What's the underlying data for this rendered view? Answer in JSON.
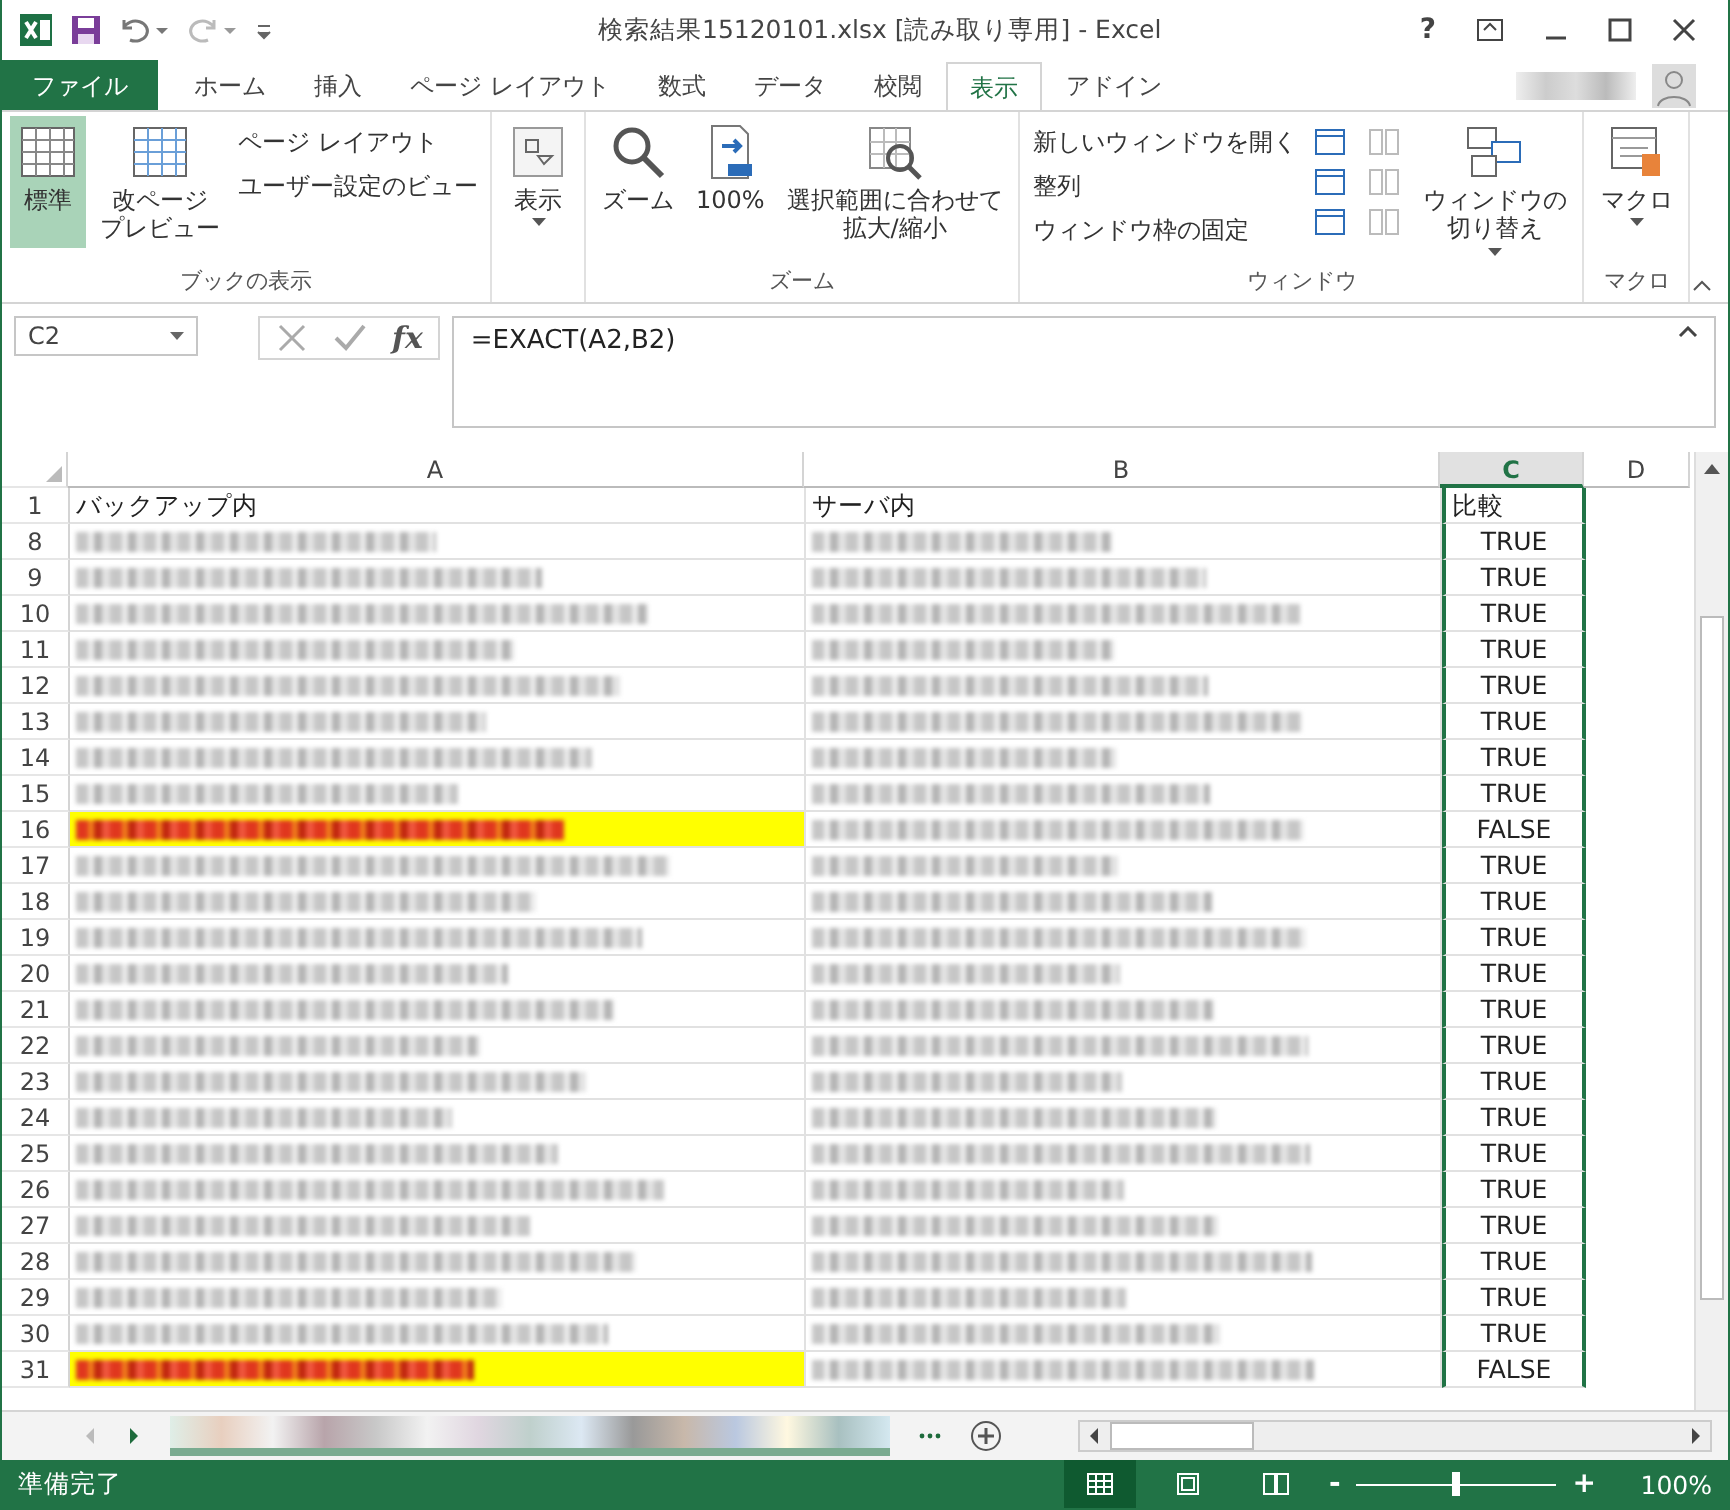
{
  "window": {
    "title": "検索結果15120101.xlsx  [読み取り専用] - Excel",
    "help": "?"
  },
  "tabs": [
    {
      "label": "ファイル",
      "kind": "file",
      "selected": false
    },
    {
      "label": "ホーム",
      "kind": "tab",
      "selected": false
    },
    {
      "label": "挿入",
      "kind": "tab",
      "selected": false
    },
    {
      "label": "ページ レイアウト",
      "kind": "tab",
      "selected": false
    },
    {
      "label": "数式",
      "kind": "tab",
      "selected": false
    },
    {
      "label": "データ",
      "kind": "tab",
      "selected": false
    },
    {
      "label": "校閲",
      "kind": "tab",
      "selected": false
    },
    {
      "label": "表示",
      "kind": "tab",
      "selected": true
    },
    {
      "label": "アドイン",
      "kind": "tab",
      "selected": false
    }
  ],
  "ribbon": {
    "groups": [
      {
        "label": "ブックの表示",
        "large": [
          {
            "lines": [
              "標準"
            ],
            "selected": true,
            "dropdown": false
          },
          {
            "lines": [
              "改ページ",
              "プレビュー"
            ],
            "selected": false,
            "dropdown": false
          }
        ],
        "small": [
          "ページ レイアウト",
          "ユーザー設定のビュー"
        ]
      },
      {
        "large": [
          {
            "lines": [
              "表示"
            ],
            "selected": false,
            "dropdown": true
          }
        ]
      },
      {
        "label": "ズーム",
        "large": [
          {
            "lines": [
              "ズーム"
            ],
            "selected": false,
            "dropdown": false
          },
          {
            "lines": [
              "100%"
            ],
            "selected": false,
            "dropdown": false
          },
          {
            "lines": [
              "選択範囲に合わせて",
              "拡大/縮小"
            ],
            "selected": false,
            "dropdown": false
          }
        ]
      },
      {
        "label": "ウィンドウ",
        "large": [
          {
            "lines": [
              "ウィンドウの",
              "切り替え"
            ],
            "selected": false,
            "dropdown": true
          }
        ],
        "small": [
          "新しいウィンドウを開く",
          "整列",
          "ウィンドウ枠の固定"
        ]
      },
      {
        "label": "マクロ",
        "large": [
          {
            "lines": [
              "マクロ"
            ],
            "selected": false,
            "dropdown": true
          }
        ]
      }
    ]
  },
  "formula_bar": {
    "name_box": "C2",
    "formula": "=EXACT(A2,B2)",
    "fx": "fx"
  },
  "columns": [
    {
      "label": "A",
      "selected": false
    },
    {
      "label": "B",
      "selected": false
    },
    {
      "label": "C",
      "selected": true
    },
    {
      "label": "D",
      "selected": false
    }
  ],
  "header_row": {
    "num": "1",
    "a": "バックアップ内",
    "b": "サーバ内",
    "c": "比較"
  },
  "rows": [
    {
      "num": "8",
      "c": "TRUE",
      "highlighted": false
    },
    {
      "num": "9",
      "c": "TRUE",
      "highlighted": false
    },
    {
      "num": "10",
      "c": "TRUE",
      "highlighted": false
    },
    {
      "num": "11",
      "c": "TRUE",
      "highlighted": false
    },
    {
      "num": "12",
      "c": "TRUE",
      "highlighted": false
    },
    {
      "num": "13",
      "c": "TRUE",
      "highlighted": false
    },
    {
      "num": "14",
      "c": "TRUE",
      "highlighted": false
    },
    {
      "num": "15",
      "c": "TRUE",
      "highlighted": false
    },
    {
      "num": "16",
      "c": "FALSE",
      "highlighted": true
    },
    {
      "num": "17",
      "c": "TRUE",
      "highlighted": false
    },
    {
      "num": "18",
      "c": "TRUE",
      "highlighted": false
    },
    {
      "num": "19",
      "c": "TRUE",
      "highlighted": false
    },
    {
      "num": "20",
      "c": "TRUE",
      "highlighted": false
    },
    {
      "num": "21",
      "c": "TRUE",
      "highlighted": false
    },
    {
      "num": "22",
      "c": "TRUE",
      "highlighted": false
    },
    {
      "num": "23",
      "c": "TRUE",
      "highlighted": false
    },
    {
      "num": "24",
      "c": "TRUE",
      "highlighted": false
    },
    {
      "num": "25",
      "c": "TRUE",
      "highlighted": false
    },
    {
      "num": "26",
      "c": "TRUE",
      "highlighted": false
    },
    {
      "num": "27",
      "c": "TRUE",
      "highlighted": false
    },
    {
      "num": "28",
      "c": "TRUE",
      "highlighted": false
    },
    {
      "num": "29",
      "c": "TRUE",
      "highlighted": false
    },
    {
      "num": "30",
      "c": "TRUE",
      "highlighted": false
    },
    {
      "num": "31",
      "c": "FALSE",
      "highlighted": true
    }
  ],
  "status_bar": {
    "status": "準備完了",
    "zoom": "100%",
    "level": 0.5,
    "minus": "-",
    "plus": "+"
  }
}
